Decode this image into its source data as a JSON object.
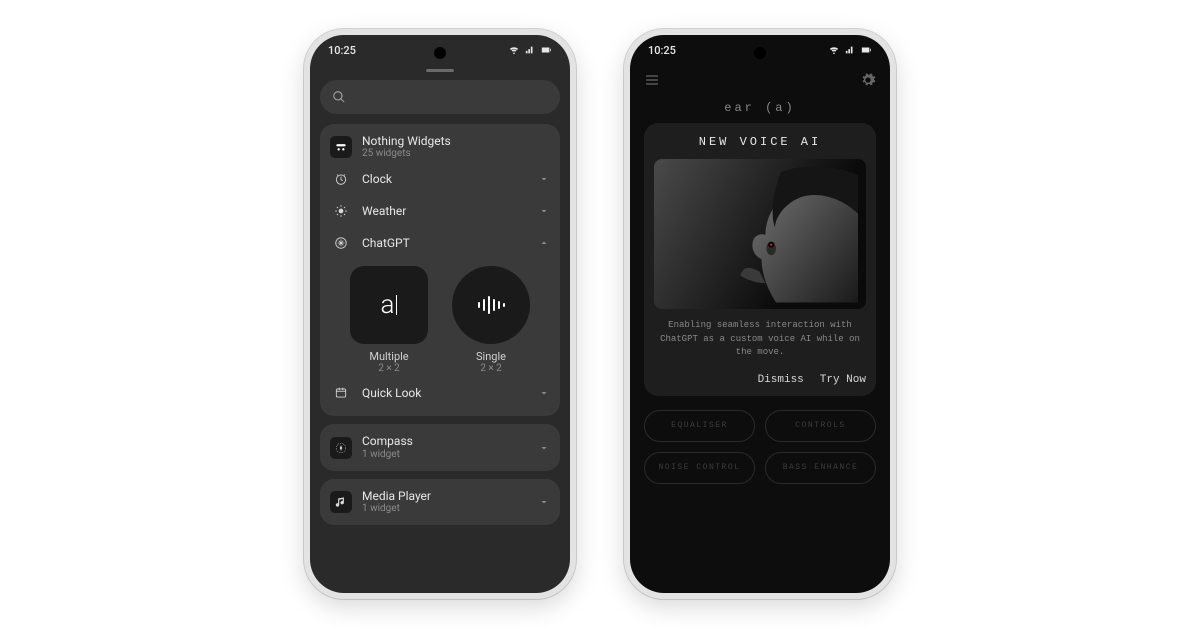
{
  "status": {
    "time": "10:25"
  },
  "widgets_screen": {
    "header": {
      "title": "Nothing Widgets",
      "subtitle": "25 widgets"
    },
    "categories": [
      {
        "label": "Clock",
        "icon": "clock"
      },
      {
        "label": "Weather",
        "icon": "weather"
      },
      {
        "label": "ChatGPT",
        "icon": "chatgpt",
        "expanded": true
      }
    ],
    "chatgpt_widgets": [
      {
        "label": "Multiple",
        "size": "2 × 2"
      },
      {
        "label": "Single",
        "size": "2 × 2"
      }
    ],
    "quicklook": {
      "label": "Quick Look"
    },
    "apps": [
      {
        "title": "Compass",
        "subtitle": "1 widget"
      },
      {
        "title": "Media Player",
        "subtitle": "1 widget"
      }
    ]
  },
  "ear_screen": {
    "product": "ear (a)",
    "modal": {
      "title": "NEW VOICE AI",
      "description": "Enabling seamless interaction with ChatGPT as a custom voice AI while on the move.",
      "dismiss": "Dismiss",
      "try": "Try Now"
    },
    "pills": [
      "EQUALISER",
      "CONTROLS",
      "NOISE CONTROL",
      "BASS ENHANCE"
    ]
  }
}
